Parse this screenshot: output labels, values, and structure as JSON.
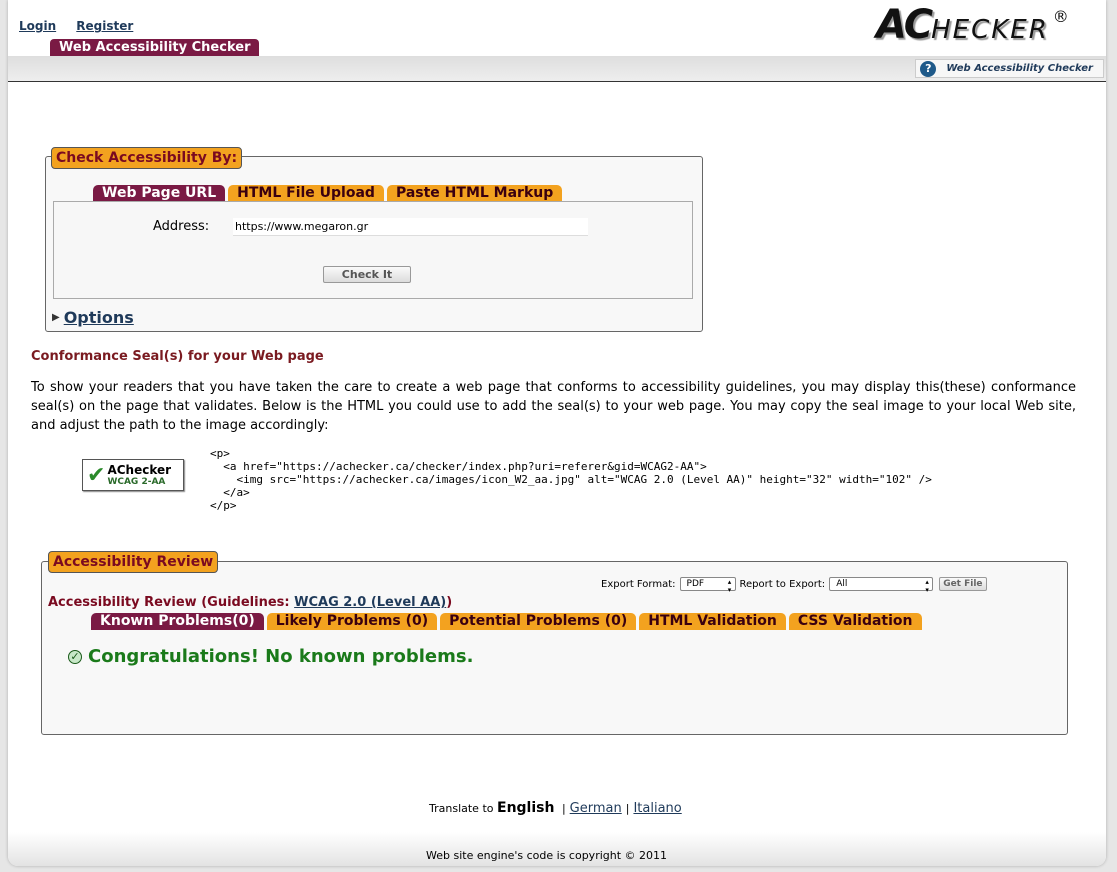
{
  "header": {
    "login": "Login",
    "register": "Register",
    "logo_first": "AC",
    "logo_rest": "HECKER",
    "logo_reg": "®",
    "site_tab": "Web Accessibility Checker",
    "help_label": "Web Accessibility Checker",
    "help_icon": "question-icon"
  },
  "check": {
    "legend": "Check Accessibility By:",
    "tabs": [
      "Web Page URL",
      "HTML File Upload",
      "Paste HTML Markup"
    ],
    "address_label": "Address:",
    "address_value": "https://www.megaron.gr",
    "check_button": "Check It",
    "options_label": "Options"
  },
  "seal": {
    "heading": "Conformance Seal(s) for your Web page",
    "text": "To show your readers that you have taken the care to create a web page that conforms to accessibility guidelines, you may display this(these) conformance seal(s) on the page that validates. Below is the HTML you could use to add the seal(s) to your web page. You may copy the seal image to your local Web site, and adjust the path to the image accordingly:",
    "badge_title": "AChecker",
    "badge_sub": "WCAG 2-AA",
    "code": "<p>\n  <a href=\"https://achecker.ca/checker/index.php?uri=referer&gid=WCAG2-AA\">\n    <img src=\"https://achecker.ca/images/icon_W2_aa.jpg\" alt=\"WCAG 2.0 (Level AA)\" height=\"32\" width=\"102\" />\n  </a>\n</p>"
  },
  "review": {
    "legend": "Accessibility Review",
    "title_prefix": "Accessibility Review (Guidelines: ",
    "guideline_link": "WCAG 2.0 (Level AA)",
    "title_suffix": ")",
    "export_format_label": "Export Format:",
    "export_format_value": "PDF",
    "report_label": "Report to Export:",
    "report_value": "All",
    "get_file": "Get File",
    "tabs": [
      "Known Problems(0)",
      "Likely Problems (0)",
      "Potential Problems (0)",
      "HTML Validation",
      "CSS Validation"
    ],
    "congrats": "Congratulations! No known problems."
  },
  "footer": {
    "translate_prefix": "Translate to",
    "current_language": "English",
    "languages": [
      "German",
      "Italiano"
    ],
    "copyright": "Web site engine's code is copyright © 2011"
  },
  "colors": {
    "tab_active": "#7a1a44",
    "tab_orange": "#f3a21f",
    "heading_red": "#7a1a20",
    "link_blue": "#1f3a5a",
    "success_green": "#1a7a1a"
  }
}
